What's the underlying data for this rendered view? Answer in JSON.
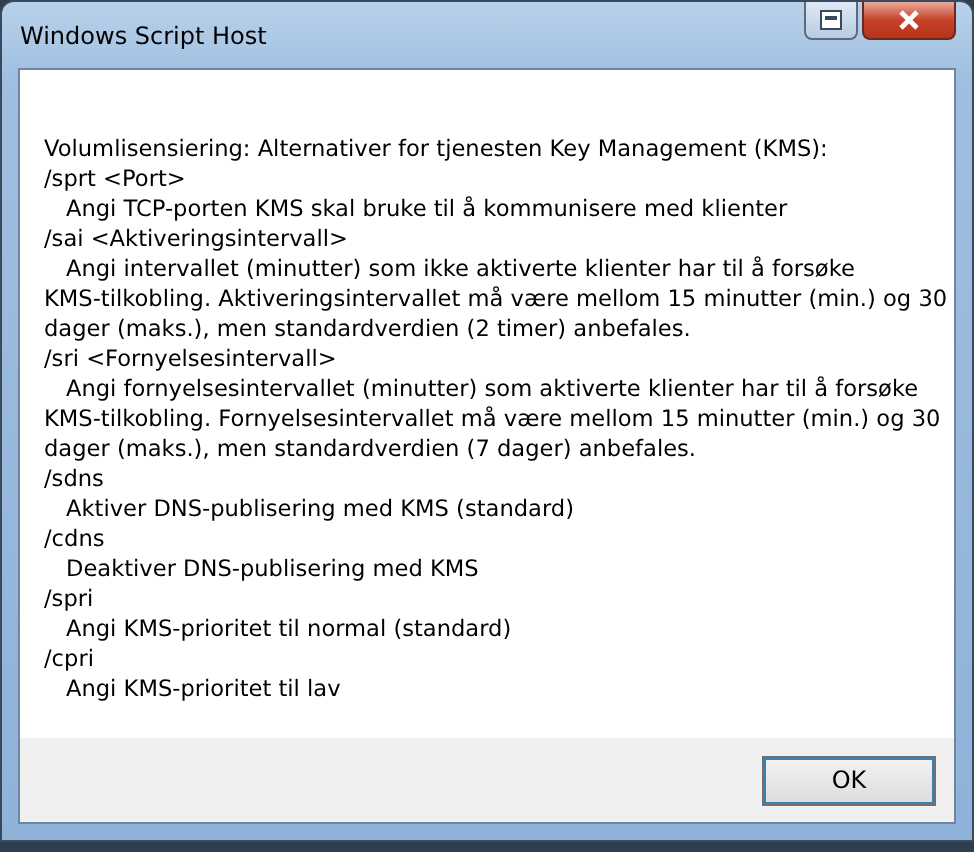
{
  "window": {
    "title": "Windows Script Host"
  },
  "message": [
    {
      "kind": "heading",
      "lines": [
        "Volumlisensiering: Alternativer for tjenesten Key Management (KMS):"
      ]
    },
    {
      "kind": "option",
      "lines": [
        "/sprt <Port>"
      ]
    },
    {
      "kind": "description",
      "lines": [
        "Angi TCP-porten KMS skal bruke til å kommunisere med klienter"
      ]
    },
    {
      "kind": "option",
      "lines": [
        "/sai <Aktiveringsintervall>"
      ]
    },
    {
      "kind": "description",
      "lines": [
        "Angi intervallet (minutter) som ikke aktiverte klienter har til å forsøke",
        "KMS-tilkobling. Aktiveringsintervallet må være mellom 15 minutter (min.) og 30",
        "dager (maks.), men standardverdien (2 timer) anbefales."
      ]
    },
    {
      "kind": "option",
      "lines": [
        "/sri <Fornyelsesintervall>"
      ]
    },
    {
      "kind": "description",
      "lines": [
        "Angi fornyelsesintervallet (minutter) som aktiverte klienter har til å forsøke",
        "KMS-tilkobling. Fornyelsesintervallet må være mellom 15 minutter (min.) og 30",
        "dager (maks.), men standardverdien (7 dager) anbefales."
      ]
    },
    {
      "kind": "option",
      "lines": [
        "/sdns"
      ]
    },
    {
      "kind": "description",
      "lines": [
        "Aktiver DNS-publisering med KMS (standard)"
      ]
    },
    {
      "kind": "option",
      "lines": [
        "/cdns"
      ]
    },
    {
      "kind": "description",
      "lines": [
        "Deaktiver DNS-publisering med KMS"
      ]
    },
    {
      "kind": "option",
      "lines": [
        "/spri"
      ]
    },
    {
      "kind": "description",
      "lines": [
        "Angi KMS-prioritet til normal (standard)"
      ]
    },
    {
      "kind": "option",
      "lines": [
        "/cpri"
      ]
    },
    {
      "kind": "description",
      "lines": [
        "Angi KMS-prioritet til lav"
      ]
    }
  ],
  "buttons": [
    {
      "label": "OK"
    }
  ]
}
